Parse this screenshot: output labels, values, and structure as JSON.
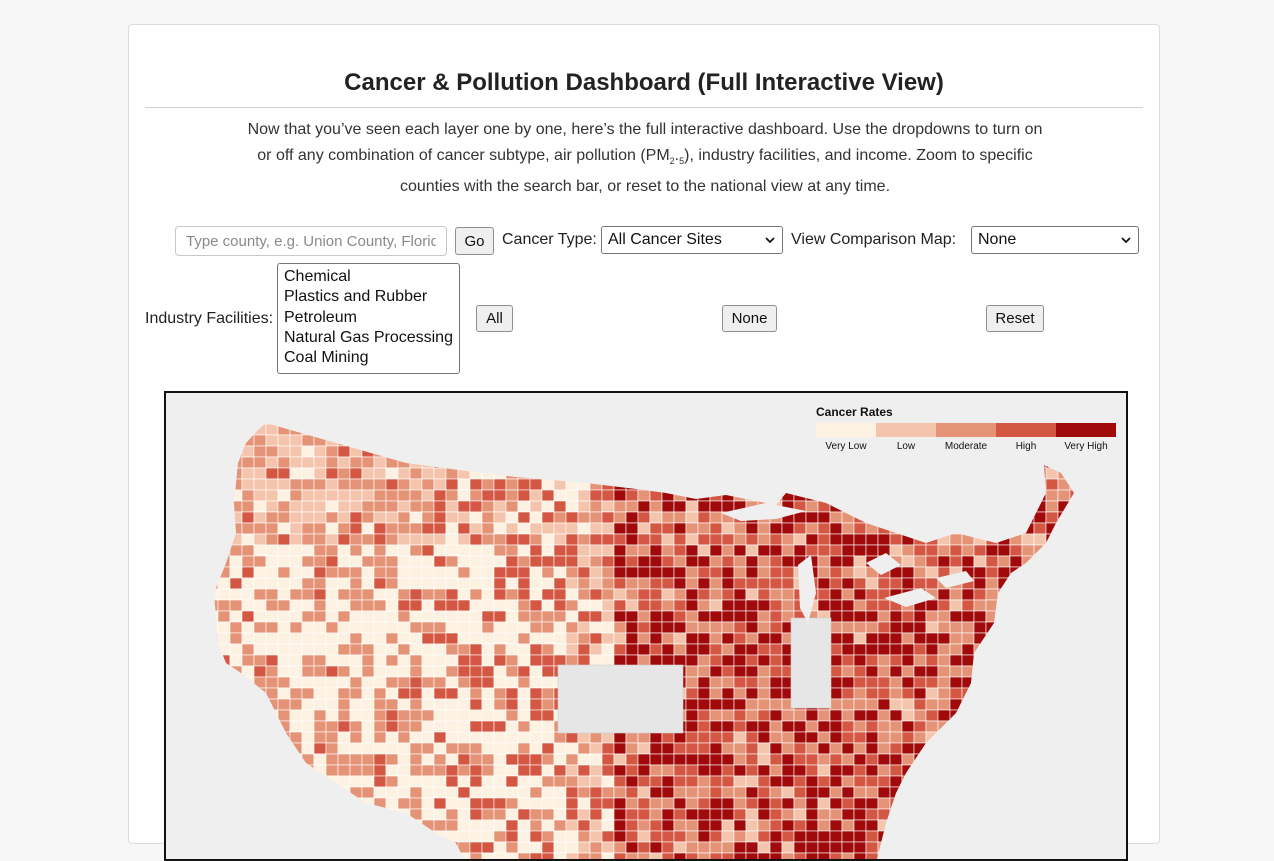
{
  "title": "Cancer & Pollution Dashboard (Full Interactive View)",
  "intro": {
    "line1": "Now that you’ve seen each layer one by one, here’s the full interactive dashboard. Use the dropdowns to turn on",
    "line2_pre": "or off any combination of cancer subtype, air pollution (PM",
    "line2_sub": "2",
    "line2_mid": ".",
    "line2_sub2": "5",
    "line2_post": "), industry facilities, and income. Zoom to specific",
    "line3": "counties with the search bar, or reset to the national view at any time."
  },
  "search": {
    "placeholder": "Type county, e.g. Union County, Florida",
    "value": ""
  },
  "go_label": "Go",
  "cancer_type": {
    "label": "Cancer Type:",
    "selected": "All Cancer Sites"
  },
  "comparison": {
    "label": "View Comparison Map:",
    "selected": "None"
  },
  "industry": {
    "label": "Industry Facilities:",
    "options": [
      "Chemical",
      "Plastics and Rubber",
      "Petroleum",
      "Natural Gas Processing",
      "Coal Mining"
    ]
  },
  "buttons": {
    "all": "All",
    "none": "None",
    "reset": "Reset"
  },
  "legend": {
    "title": "Cancer Rates",
    "labels": [
      "Very Low",
      "Low",
      "Moderate",
      "High",
      "Very High"
    ],
    "colors": [
      "#fdf1e2",
      "#f5c4ac",
      "#e59377",
      "#d45743",
      "#a10a0a"
    ]
  },
  "map_colors": {
    "background": "#efefef",
    "no_data": "#e6e6e6",
    "border": "#ffffff"
  }
}
